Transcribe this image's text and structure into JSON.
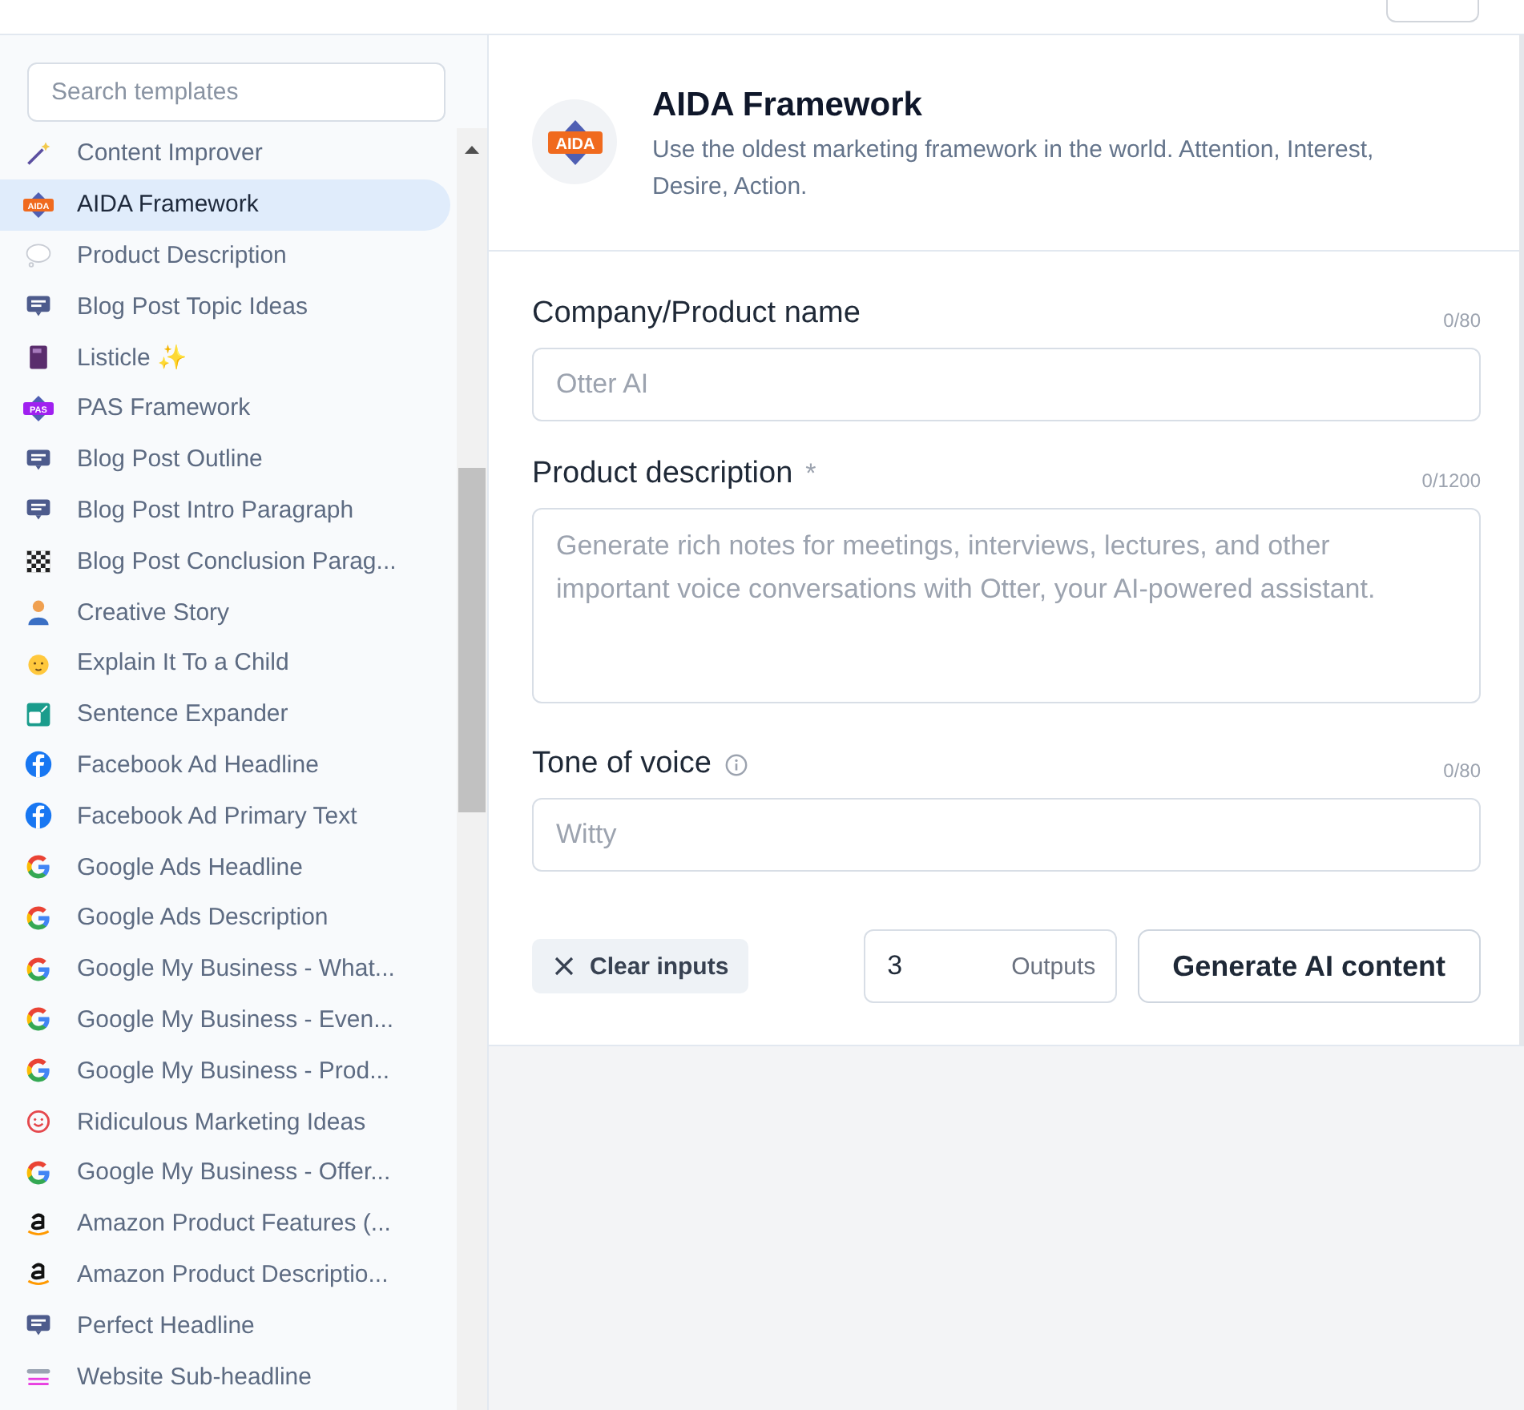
{
  "sidebar": {
    "search": {
      "placeholder": "Search templates"
    },
    "items": [
      {
        "label": "Content Improver",
        "kind": "wand",
        "selected": false
      },
      {
        "label": "AIDA Framework",
        "kind": "badge",
        "badge": "AIDA",
        "selected": true
      },
      {
        "label": "Product Description",
        "kind": "bubble",
        "selected": false
      },
      {
        "label": "Blog Post Topic Ideas",
        "kind": "chat",
        "selected": false
      },
      {
        "label": "Listicle ✨",
        "kind": "book",
        "selected": false
      },
      {
        "label": "PAS Framework",
        "kind": "badge2",
        "badge": "PAS",
        "selected": false
      },
      {
        "label": "Blog Post Outline",
        "kind": "chat",
        "selected": false
      },
      {
        "label": "Blog Post Intro Paragraph",
        "kind": "chat",
        "selected": false
      },
      {
        "label": "Blog Post Conclusion Parag...",
        "kind": "checker",
        "selected": false
      },
      {
        "label": "Creative Story",
        "kind": "person",
        "selected": false
      },
      {
        "label": "Explain It To a Child",
        "kind": "baby",
        "selected": false
      },
      {
        "label": "Sentence Expander",
        "kind": "expander",
        "selected": false
      },
      {
        "label": "Facebook Ad Headline",
        "kind": "facebook",
        "selected": false
      },
      {
        "label": "Facebook Ad Primary Text",
        "kind": "facebook",
        "selected": false
      },
      {
        "label": "Google Ads Headline",
        "kind": "google",
        "selected": false
      },
      {
        "label": "Google Ads Description",
        "kind": "google",
        "selected": false
      },
      {
        "label": "Google My Business - What...",
        "kind": "google",
        "selected": false
      },
      {
        "label": "Google My Business - Even...",
        "kind": "google",
        "selected": false
      },
      {
        "label": "Google My Business - Prod...",
        "kind": "google",
        "selected": false
      },
      {
        "label": "Ridiculous Marketing Ideas",
        "kind": "smiley",
        "selected": false
      },
      {
        "label": "Google My Business - Offer...",
        "kind": "google",
        "selected": false
      },
      {
        "label": "Amazon Product Features (...",
        "kind": "amazon",
        "selected": false
      },
      {
        "label": "Amazon Product Descriptio...",
        "kind": "amazon",
        "selected": false
      },
      {
        "label": "Perfect Headline",
        "kind": "chat",
        "selected": false
      },
      {
        "label": "Website Sub-headline",
        "kind": "lines",
        "selected": false
      }
    ]
  },
  "template": {
    "badge": "AIDA",
    "title": "AIDA Framework",
    "description": "Use the oldest marketing framework in the world. Attention, Interest, Desire, Action."
  },
  "fields": [
    {
      "label": "Company/Product name",
      "counter": "0/80",
      "placeholder": "Otter AI",
      "kind": "input"
    },
    {
      "label": "Product description",
      "required_mark": "*",
      "counter": "0/1200",
      "placeholder": "Generate rich notes for meetings, interviews, lectures, and other important voice conversations with Otter, your AI-powered assistant.",
      "kind": "textarea"
    },
    {
      "label": "Tone of voice",
      "info": true,
      "counter": "0/80",
      "placeholder": "Witty",
      "kind": "input"
    }
  ],
  "actions": {
    "clear": "Clear inputs",
    "outputs_value": "3",
    "outputs_label": "Outputs",
    "generate": "Generate AI content"
  }
}
